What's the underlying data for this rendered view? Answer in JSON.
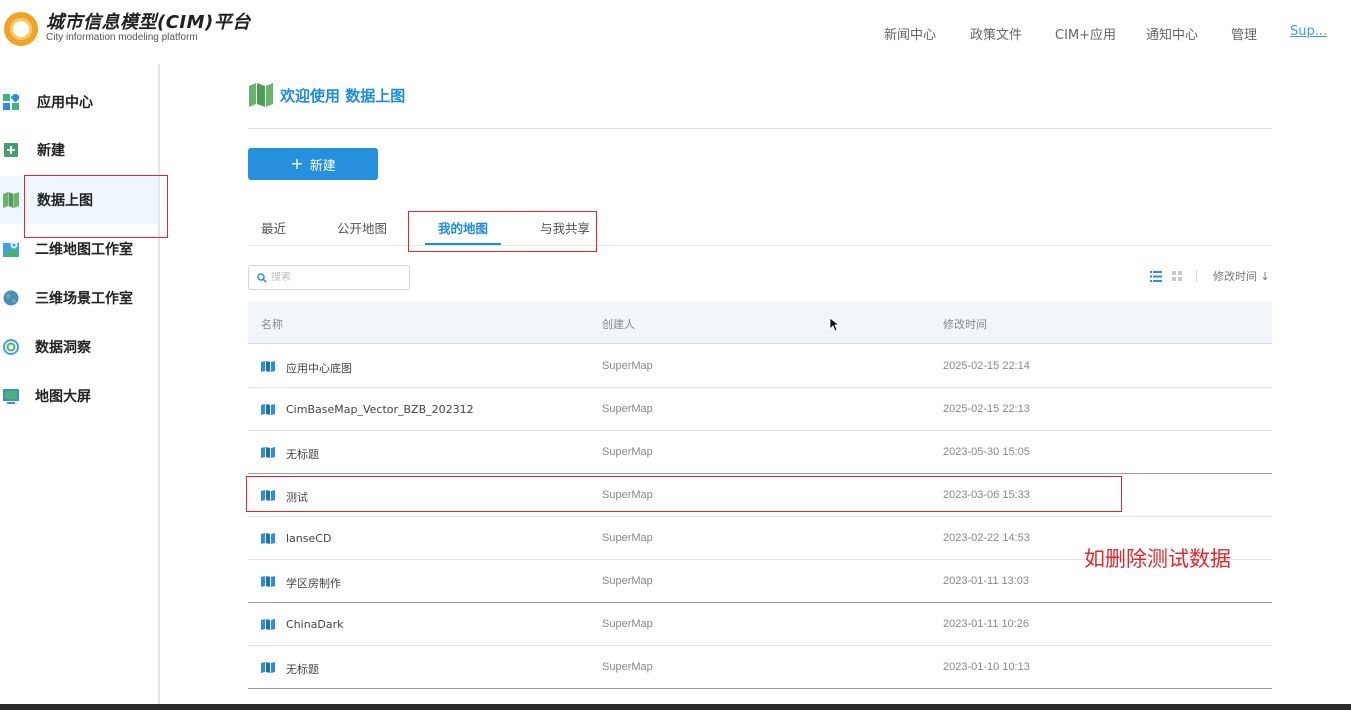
{
  "header": {
    "title": "城市信息模型(CIM)平台",
    "subtitle": "City information modeling platform",
    "nav": [
      "新闻中心",
      "政策文件",
      "CIM+应用",
      "通知中心",
      "管理"
    ],
    "user": "Sup..."
  },
  "sidebar": {
    "items": [
      {
        "label": "应用中心",
        "icon": "app-grid-icon"
      },
      {
        "label": "新建",
        "icon": "add-square-icon"
      },
      {
        "label": "数据上图",
        "icon": "map-icon"
      },
      {
        "label": "二维地图工作室",
        "icon": "map-pin-icon"
      },
      {
        "label": "三维场景工作室",
        "icon": "globe-icon"
      },
      {
        "label": "数据洞察",
        "icon": "insight-icon"
      },
      {
        "label": "地图大屏",
        "icon": "screen-icon"
      }
    ],
    "active_index": 2
  },
  "main": {
    "page_title": "欢迎使用 数据上图",
    "new_button": "新建",
    "tabs": [
      "最近",
      "公开地图",
      "我的地图",
      "与我共享"
    ],
    "active_tab": 2,
    "search_placeholder": "搜索",
    "sort_label": "修改时间",
    "columns": [
      "名称",
      "创建人",
      "修改时间"
    ],
    "rows": [
      {
        "name": "应用中心底图",
        "creator": "SuperMap",
        "time": "2025-02-15 22:14"
      },
      {
        "name": "CimBaseMap_Vector_BZB_202312",
        "creator": "SuperMap",
        "time": "2025-02-15 22:13"
      },
      {
        "name": "无标题",
        "creator": "SuperMap",
        "time": "2023-05-30 15:05"
      },
      {
        "name": "测试",
        "creator": "SuperMap",
        "time": "2023-03-06 15:33"
      },
      {
        "name": "lanseCD",
        "creator": "SuperMap",
        "time": "2023-02-22 14:53"
      },
      {
        "name": "学区房制作",
        "creator": "SuperMap",
        "time": "2023-01-11 13:03"
      },
      {
        "name": "ChinaDark",
        "creator": "SuperMap",
        "time": "2023-01-11 10:26"
      },
      {
        "name": "无标题",
        "creator": "SuperMap",
        "time": "2023-01-10 10:13"
      }
    ]
  },
  "annotation": "如删除测试数据",
  "colors": {
    "accent": "#1e8be3",
    "annotation": "#e0282d",
    "logo": "#f2a324"
  }
}
